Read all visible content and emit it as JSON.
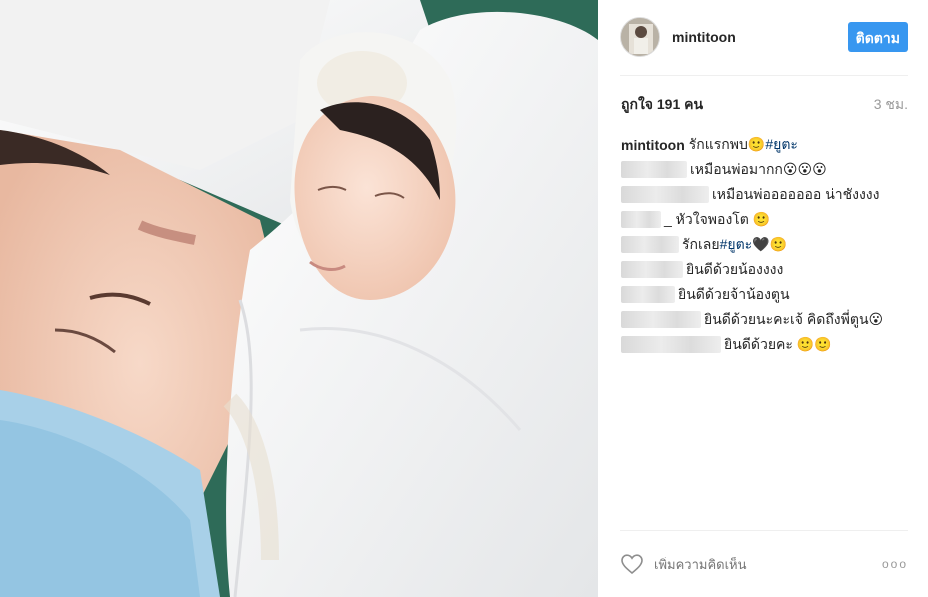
{
  "post": {
    "username": "mintitoon",
    "follow_label": "ติดตาม",
    "likes": "ถูกใจ 191 คน",
    "time": "3 ชม.",
    "comments": [
      {
        "author": "mintitoon",
        "text": "รักแรกพบ ",
        "emoji": "🙂",
        "hashtag": "#ยูตะ",
        "blurred": false
      },
      {
        "text": "เหมือนพ่อมากก😮😮😮",
        "blurred": true
      },
      {
        "text": "เหมือนพ่อออออออ น่าชังงงง",
        "blurred": true
      },
      {
        "text": "_ หัวใจพองโต 🙂",
        "blurred": true
      },
      {
        "text": "รักเลย ",
        "hashtag": "#ยูตะ",
        "emoji": "🖤🙂",
        "blurred": true
      },
      {
        "text": "ยินดีด้วยน้องงงง",
        "blurred": true
      },
      {
        "text": "ยินดีด้วยจ้าน้องตูน",
        "blurred": true
      },
      {
        "text": "ยินดีด้วยนะคะเจ้ คิดถึงพี่ตูน😮",
        "blurred": true
      },
      {
        "text": "ยินดีด้วยคะ 🙂🙂",
        "blurred": true
      }
    ],
    "add_comment_placeholder": "เพิ่มความคิดเห็น",
    "more_label": "ooo"
  },
  "icons": {
    "like": "heart-outline-icon",
    "more": "ellipsis-icon"
  },
  "colors": {
    "follow": "#3897f0",
    "hashtag": "#003569",
    "muted": "#999999",
    "divider": "#efefef"
  }
}
